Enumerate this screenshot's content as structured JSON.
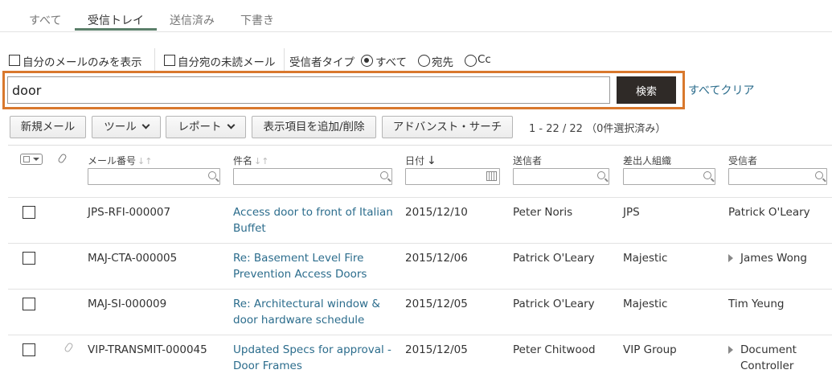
{
  "tabs": [
    {
      "label": "すべて"
    },
    {
      "label": "受信トレイ"
    },
    {
      "label": "送信済み"
    },
    {
      "label": "下書き"
    }
  ],
  "filters": {
    "only_mine": "自分のメールのみを表示",
    "unread_to_me": "自分宛の未読メール",
    "recipient_type_label": "受信者タイプ",
    "option_all": "すべて",
    "option_to": "宛先",
    "option_cc": "Cc"
  },
  "search": {
    "value": "door",
    "button": "検索",
    "clear_all": "すべてクリア"
  },
  "toolbar": {
    "new_mail": "新規メール",
    "tools": "ツール",
    "report": "レポート",
    "columns": "表示項目を追加/削除",
    "advanced_search": "アドバンスト・サーチ",
    "count": "1 - 22 / 22 （0件選択済み）"
  },
  "columns": {
    "mail_no": "メール番号",
    "subject": "件名",
    "date": "日付",
    "sender": "送信者",
    "org": "差出人組織",
    "recipient": "受信者"
  },
  "rows": [
    {
      "mail_no": "JPS-RFI-000007",
      "subject_line1": "Access door to front of Italian",
      "subject_line2": "Buffet",
      "date": "2015/12/10",
      "sender": "Peter Noris",
      "org": "JPS",
      "recipient_line1": "Patrick O'Leary",
      "recipient_line2": ""
    },
    {
      "mail_no": "MAJ-CTA-000005",
      "subject_line1": "Re: Basement Level Fire",
      "subject_line2": "Prevention Access Doors",
      "date": "2015/12/06",
      "sender": "Patrick O'Leary",
      "org": "Majestic",
      "recipient_line1": "James Wong",
      "recipient_line2": ""
    },
    {
      "mail_no": "MAJ-SI-000009",
      "subject_line1": "Re: Architectural window &",
      "subject_line2": "door hardware schedule",
      "date": "2015/12/05",
      "sender": "Patrick O'Leary",
      "org": "Majestic",
      "recipient_line1": "Tim Yeung",
      "recipient_line2": ""
    },
    {
      "mail_no": "VIP-TRANSMIT-000045",
      "subject_line1": "Updated Specs for approval -",
      "subject_line2": "Door Frames",
      "date": "2015/12/05",
      "sender": "Peter Chitwood",
      "org": "VIP Group",
      "recipient_line1": "Document",
      "recipient_line2": "Controller"
    }
  ]
}
